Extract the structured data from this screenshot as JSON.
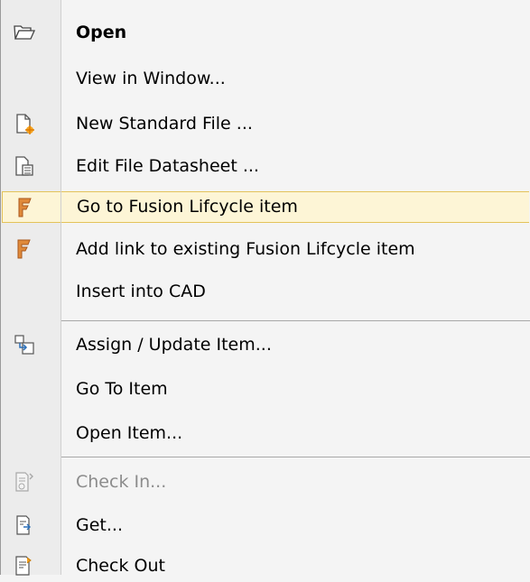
{
  "menu": {
    "items": [
      {
        "label": "Open",
        "icon": "open-folder-icon"
      },
      {
        "label": "View in Window...",
        "icon": null
      },
      {
        "label": "New Standard File ...",
        "icon": "new-file-icon"
      },
      {
        "label": "Edit File Datasheet ...",
        "icon": "datasheet-icon"
      },
      {
        "label": "Go to Fusion Lifcycle item",
        "icon": "fusion-icon"
      },
      {
        "label": "Add link to existing Fusion Lifcycle item",
        "icon": "fusion-icon"
      },
      {
        "label": "Insert into CAD",
        "icon": null
      },
      {
        "label": "Assign / Update Item...",
        "icon": "assign-item-icon"
      },
      {
        "label": "Go To Item",
        "icon": null
      },
      {
        "label": "Open Item...",
        "icon": null
      },
      {
        "label": "Check In...",
        "icon": "check-in-icon"
      },
      {
        "label": "Get...",
        "icon": "get-icon"
      },
      {
        "label": "Check Out",
        "icon": "check-out-icon"
      }
    ],
    "highlight_color": "#fdf5d6",
    "fusion_color": "#e08a3a"
  }
}
